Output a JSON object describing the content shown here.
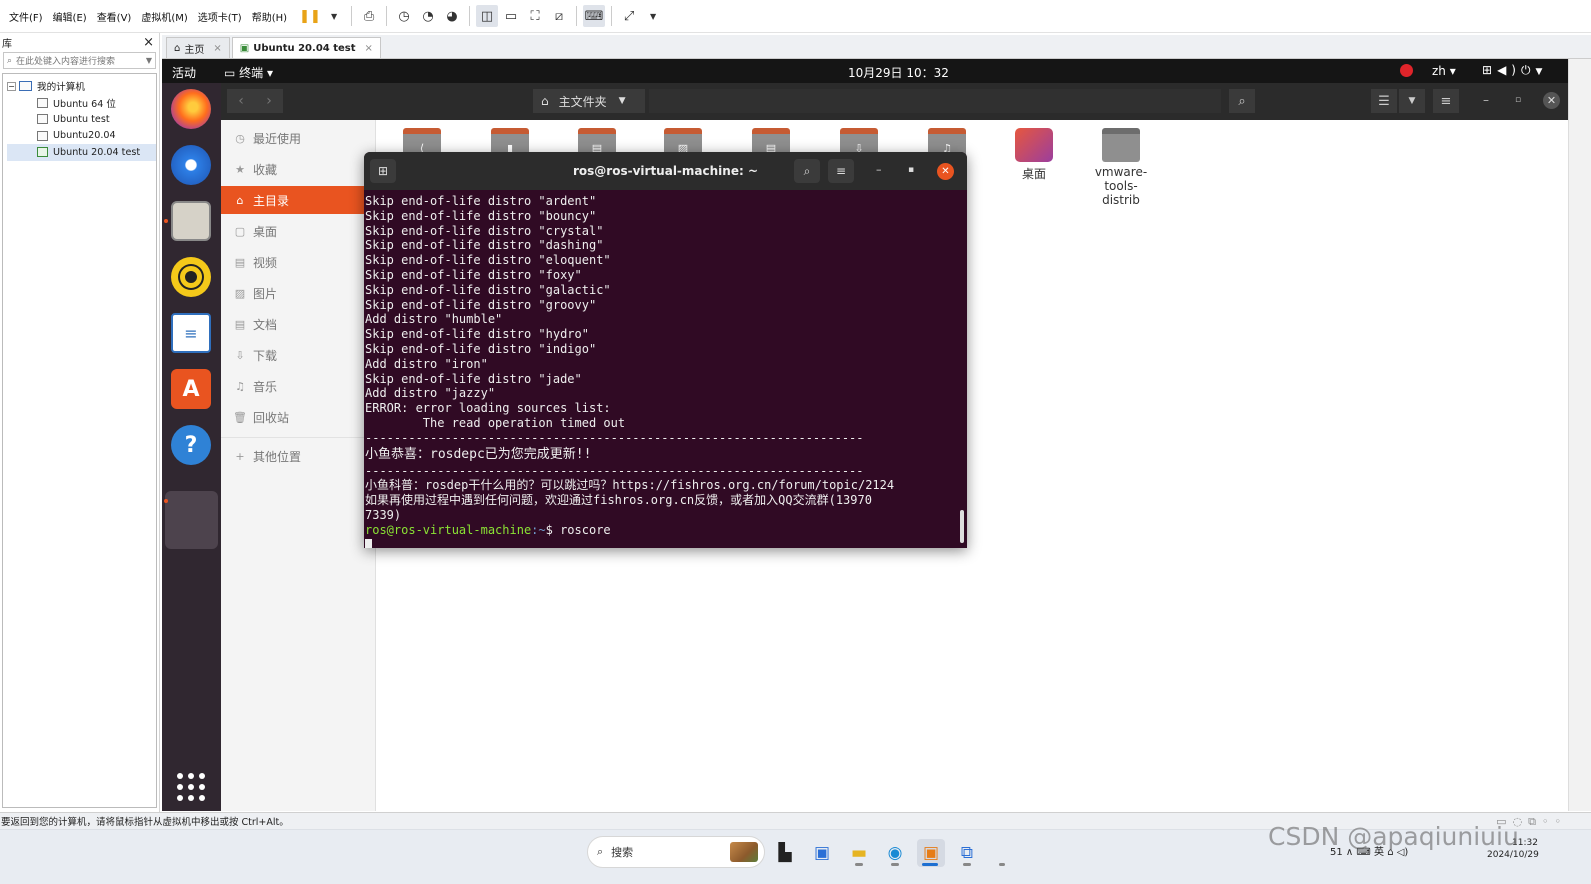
{
  "menubar": {
    "items": [
      "文件(F)",
      "编辑(E)",
      "查看(V)",
      "虚拟机(M)",
      "选项卡(T)",
      "帮助(H)"
    ]
  },
  "library": {
    "title": "库",
    "close": "×",
    "search_placeholder": "在此处键入内容进行搜索",
    "tree": {
      "root": "我的计算机",
      "items": [
        "Ubuntu 64 位",
        "Ubuntu test",
        "Ubuntu20.04",
        "Ubuntu 20.04 test"
      ]
    }
  },
  "vm_tabs": [
    {
      "label": "主页",
      "close": "×"
    },
    {
      "label": "Ubuntu 20.04 test",
      "close": "×"
    }
  ],
  "ubuntu": {
    "topbar": {
      "activities": "活动",
      "app_menu": "终端 ▾",
      "clock": "10月29日  10：32",
      "lang": "zh ▾"
    },
    "files": {
      "path_label": "主文件夹",
      "sidebar": [
        "最近使用",
        "收藏",
        "主目录",
        "桌面",
        "视频",
        "图片",
        "文档",
        "下载",
        "音乐",
        "回收站",
        "其他位置"
      ],
      "folders": [
        {
          "name": "桌面"
        },
        {
          "name": "vmware-\ntools-\ndistrib"
        }
      ]
    },
    "terminal": {
      "title": "ros@ros-virtual-machine: ~",
      "lines": [
        "Skip end-of-life distro \"ardent\"",
        "Skip end-of-life distro \"bouncy\"",
        "Skip end-of-life distro \"crystal\"",
        "Skip end-of-life distro \"dashing\"",
        "Skip end-of-life distro \"eloquent\"",
        "Skip end-of-life distro \"foxy\"",
        "Skip end-of-life distro \"galactic\"",
        "Skip end-of-life distro \"groovy\"",
        "Add distro \"humble\"",
        "Skip end-of-life distro \"hydro\"",
        "Skip end-of-life distro \"indigo\"",
        "Add distro \"iron\"",
        "Skip end-of-life distro \"jade\"",
        "Add distro \"jazzy\"",
        "ERROR: error loading sources list:",
        "        The read operation timed out",
        "---------------------------------------------------------------------",
        "小鱼恭喜：rosdepc已为您完成更新!!",
        "---------------------------------------------------------------------",
        "小鱼科普：rosdep干什么用的？可以跳过吗？https://fishros.org.cn/forum/topic/2124",
        "如果再使用过程中遇到任何问题，欢迎通过fishros.org.cn反馈，或者加入QQ交流群(13970",
        "7339)"
      ],
      "prompt_user": "ros@ros-virtual-machine",
      "prompt_path": ":~",
      "prompt_command": "$ roscore"
    }
  },
  "statusbar": {
    "text": "要返回到您的计算机，请将鼠标指针从虚拟机中移出或按 Ctrl+Alt。"
  },
  "taskbar": {
    "search_label": "搜索",
    "watermark": "CSDN @apaqiuniuiu",
    "tray": "51  ∧  ⌨  英  ⌂  ◁)",
    "date": "2024/10/29",
    "time": "11:32"
  }
}
